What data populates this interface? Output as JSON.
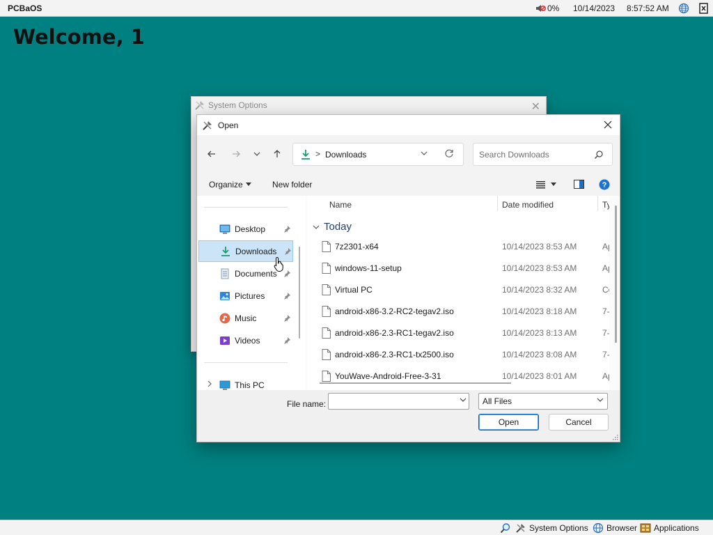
{
  "topbar": {
    "os_name": "PCBaOS",
    "battery": "0%",
    "date": "10/14/2023",
    "time": "8:57:52 AM",
    "icons": [
      "volume-muted-icon",
      "globe-icon",
      "exit-icon"
    ]
  },
  "desktop": {
    "welcome": "Welcome, 1"
  },
  "taskbar": {
    "items": [
      {
        "label": "System Options",
        "icon": "system-options-icon"
      },
      {
        "label": "Browser",
        "icon": "browser-globe-icon"
      },
      {
        "label": "Applications",
        "icon": "applications-icon"
      }
    ],
    "search_icon": "search-icon"
  },
  "bg_window": {
    "title": "System Options"
  },
  "dialog": {
    "title": "Open",
    "address": {
      "location": "Downloads",
      "separator": ">"
    },
    "search_placeholder": "Search Downloads",
    "toolbar": {
      "organize": "Organize",
      "new_folder": "New folder"
    },
    "nav": {
      "items": [
        {
          "label": "Desktop",
          "icon": "desktop-icon",
          "pinned": true
        },
        {
          "label": "Downloads",
          "icon": "downloads-icon",
          "pinned": true,
          "selected": true
        },
        {
          "label": "Documents",
          "icon": "documents-icon",
          "pinned": true
        },
        {
          "label": "Pictures",
          "icon": "pictures-icon",
          "pinned": true
        },
        {
          "label": "Music",
          "icon": "music-icon",
          "pinned": true
        },
        {
          "label": "Videos",
          "icon": "videos-icon",
          "pinned": true
        }
      ],
      "this_pc": "This PC"
    },
    "columns": {
      "name": "Name",
      "date_modified": "Date modified",
      "type": "Ty"
    },
    "group": "Today",
    "files": [
      {
        "name": "7z2301-x64",
        "date": "10/14/2023 8:53 AM",
        "type": "Ap"
      },
      {
        "name": "windows-11-setup",
        "date": "10/14/2023 8:53 AM",
        "type": "Ap"
      },
      {
        "name": "Virtual PC",
        "date": "10/14/2023 8:32 AM",
        "type": "Co"
      },
      {
        "name": "android-x86-3.2-RC2-tegav2.iso",
        "date": "10/14/2023 8:18 AM",
        "type": "7-"
      },
      {
        "name": "android-x86-2.3-RC1-tegav2.iso",
        "date": "10/14/2023 8:13 AM",
        "type": "7-"
      },
      {
        "name": "android-x86-2.3-RC1-tx2500.iso",
        "date": "10/14/2023 8:08 AM",
        "type": "7-"
      },
      {
        "name": "YouWave-Android-Free-3-31",
        "date": "10/14/2023 8:01 AM",
        "type": "Ap"
      }
    ],
    "footer": {
      "file_name_label": "File name:",
      "file_name_value": "",
      "filter": "All Files",
      "open": "Open",
      "cancel": "Cancel"
    }
  },
  "colors": {
    "desktop": "#008080",
    "selection": "#cce4f7",
    "accent": "#0067c0",
    "download_green": "#1a9c6e"
  }
}
